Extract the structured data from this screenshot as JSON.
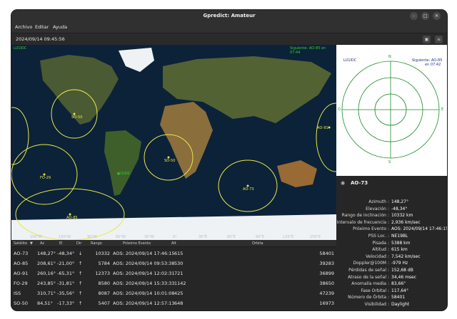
{
  "window": {
    "title": "Gpredict: Amateur"
  },
  "menu": [
    "Archivo",
    "Editar",
    "Ayuda"
  ],
  "toolbar": {
    "time": "2024/09/14 09:45:56"
  },
  "map": {
    "qth": "LU1IDC",
    "next": "Siguiente: AO-85 en 07:44",
    "satellites": [
      "SO-50",
      "AO-73",
      "FO-29",
      "AO-85",
      "AO-91",
      "ISS"
    ],
    "lon_ticks": [
      "150°W",
      "120°W",
      "90°W",
      "60°W",
      "30°W",
      "0°",
      "30°E",
      "60°E",
      "90°E",
      "120°E",
      "150°E"
    ]
  },
  "polar": {
    "qth": "LU1IDC",
    "next_line1": "Siguiente: AO-85",
    "next_line2": "en 07:42",
    "n": "N",
    "s": "S",
    "e": "E",
    "o": "O"
  },
  "details": {
    "name": "AO-73",
    "rows": [
      {
        "k": "Azimuth",
        "v": "148,27°"
      },
      {
        "k": "Elevación",
        "v": "-48,34°"
      },
      {
        "k": "Rango de inclinación",
        "v": "10332 km"
      },
      {
        "k": "Intervalo de frecuencia",
        "v": "2,936 km/sec"
      },
      {
        "k": "Próximo Evento",
        "v": "AOS: 2024/09/14 17:46:15"
      },
      {
        "k": "PSS Loc.",
        "v": "NE19BL"
      },
      {
        "k": "Pisada",
        "v": "5388 km"
      },
      {
        "k": "Altitud",
        "v": "615 km"
      },
      {
        "k": "Velocidad",
        "v": "7,542 km/sec"
      },
      {
        "k": "Doppler@100M",
        "v": "-979 Hz"
      },
      {
        "k": "Pérdidas de señal",
        "v": "152,68 dB"
      },
      {
        "k": "Atraso de la señal",
        "v": "34,46 msec"
      },
      {
        "k": "Anomalía media",
        "v": "83,66°"
      },
      {
        "k": "Fase Orbital",
        "v": "117,64°"
      },
      {
        "k": "Número de Órbita",
        "v": "58401"
      },
      {
        "k": "Visibilidad",
        "v": "Daylight"
      }
    ]
  },
  "list": {
    "headers": [
      "Satélite",
      "Az",
      "El",
      "Dir",
      "Rango",
      "Próximo Evento",
      "Alt",
      "Orbita"
    ],
    "rows": [
      [
        "AO-73",
        "148,27°",
        "-48,34°",
        "↓",
        "10332",
        "AOS: 2024/09/14 17:46:15",
        "615",
        "58401"
      ],
      [
        "AO-85",
        "208,61°",
        "-21,00°",
        "↑",
        "5784",
        "AOS: 2024/09/14 09:53:38",
        "530",
        "39283"
      ],
      [
        "AO-91",
        "260,16°",
        "-65,31°",
        "↑",
        "12373",
        "AOS: 2024/09/14 12:02:31",
        "721",
        "36899"
      ],
      [
        "FO-29",
        "243,85°",
        "-31,81°",
        "↑",
        "8580",
        "AOS: 2024/09/14 15:33:33",
        "1142",
        "38650"
      ],
      [
        "ISS",
        "310,71°",
        "-35,56°",
        "↑",
        "8087",
        "AOS: 2024/09/14 10:01:08",
        "425",
        "47239"
      ],
      [
        "SO-50",
        "84,51°",
        "-17,33°",
        "↑",
        "5407",
        "AOS: 2024/09/14 12:57:13",
        "648",
        "16973"
      ]
    ]
  },
  "colors": {
    "footprint": "#e8e84a",
    "map_label": "#2fd12f",
    "window_bg": "#2d2d2d"
  }
}
